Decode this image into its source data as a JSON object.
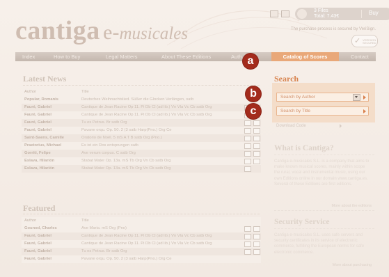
{
  "brand": {
    "logo_part1": "cantiga",
    "logo_part2": "e-",
    "logo_part3": "musicales"
  },
  "header": {
    "cart_files": "3 Files",
    "cart_total": "Total: 7.43€",
    "buy_label": "Buy",
    "secure_note": "The purchase process is secured by VeriSign.",
    "verisign_text": "VERISIGN SECURED"
  },
  "nav": {
    "items": [
      "Index",
      "How to Buy",
      "Legal Matters",
      "About These Editions",
      "Auth",
      "Catalog of Scores",
      "Contact"
    ],
    "active": "Catalog of Scores"
  },
  "markers": [
    "a",
    "b",
    "c"
  ],
  "latest_news": {
    "title": "Latest News",
    "col_author": "Author",
    "col_title": "Title",
    "rows": [
      {
        "author": "Popular, Romanis",
        "title": "Deutsches Weihnachtslied. Süßer die Glocken Verlängen, satb"
      },
      {
        "author": "Fauré, Gabriel",
        "title": "Cantique de Jean Racine Op 11. Pi Db Cl (ad lib.) Vn Vla Vc Cb satb Org"
      },
      {
        "author": "Fauré, Gabriel",
        "title": "Cantique de Jean Racine Op 11. Pi Db Cl (ad lib.) Vn Vla Vc Cb satb Org"
      },
      {
        "author": "Fauré, Gabriel",
        "title": "Tu es Petrus. Br satb Org"
      },
      {
        "author": "Fauré, Gabriel",
        "title": "Pavane orqu. Op. 50. 2 (3 satb Harp(Pno.) Org Ce"
      },
      {
        "author": "Saint-Saens, Camille",
        "title": "Oratorio de Noël. 5 mS A T B satb Org (Pno.)"
      },
      {
        "author": "Praetorius, Michael",
        "title": "Es ist ein Ros entsprungen satb"
      },
      {
        "author": "Gorriti, Felipe",
        "title": "Ave verum corpus. C satb Org"
      },
      {
        "author": "Eslava, Hilarión",
        "title": "Stabat Mater Op. 13a. mS Tb Org Vn Cb satb Org"
      },
      {
        "author": "Eslava, Hilarión",
        "title": "Stabat Mater Op. 13a. mS Tb Org Vn Cb satb Org"
      }
    ]
  },
  "featured": {
    "title": "Featured",
    "col_author": "Author",
    "col_title": "Title",
    "rows": [
      {
        "author": "Gounod, Charles",
        "title": "Ave Maria. mS Org (Pno)"
      },
      {
        "author": "Fauré, Gabriel",
        "title": "Cantique de Jean Racine Op 11. Pi Db Cl (ad lib.) Vn Vla Vc Cb satb Org"
      },
      {
        "author": "Fauré, Gabriel",
        "title": "Cantique de Jean Racine Op 11. Pi Db Cl (ad lib.) Vn Vla Vc Cb satb Org"
      },
      {
        "author": "Fauré, Gabriel",
        "title": "Tu es Petrus. Br satb Org"
      },
      {
        "author": "Fauré, Gabriel",
        "title": "Pavane orqu. Op. 50. 2 (3 satb Harp(Pno.) Org Ce"
      }
    ]
  },
  "search": {
    "title": "Search",
    "by_author": "Search by Author",
    "by_title": "Search by Title",
    "download_code": "Download Code"
  },
  "what_is": {
    "title": "What is Cantiga?",
    "text": "Cantiga e-musicales S.L. is a company that aims to make known musical scores, mainly within scope the rural, vocal and instrumental music, using our own Editions online in our domain www.cantiga.es. Several of these Editions are first editions.",
    "more": "More about the editions"
  },
  "security": {
    "title": "Security Service",
    "text": "Cantiga e-musicales S.L. uses safe servers and security certificates in its service of electronic commerce, fulfilling the European norms for safe electronic commerce.",
    "more": "More about purchasing"
  },
  "colors": {
    "accent": "#e9a879",
    "marker": "#a32b1c",
    "search_bg": "#f4ddc9"
  }
}
